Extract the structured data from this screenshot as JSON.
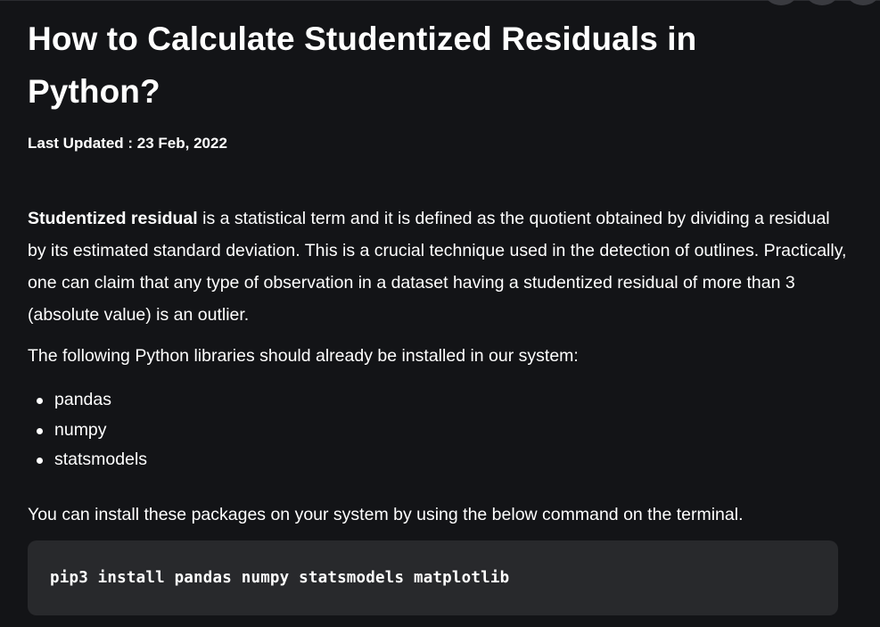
{
  "article": {
    "title": "How to Calculate Studentized Residuals in Python?",
    "last_updated": "Last Updated : 23 Feb, 2022",
    "intro": {
      "bold_term": "Studentized residual",
      "rest": " is a statistical term and it is defined as the quotient obtained by dividing a residual by its estimated standard deviation. This is a crucial technique used in the detection of outlines. Practically, one can claim that any type of observation in a dataset having a studentized residual of more than 3 (absolute value) is an outlier."
    },
    "libraries_intro": "The following Python libraries should already be installed in our system:",
    "libraries": [
      "pandas",
      "numpy",
      "statsmodels"
    ],
    "install_note": "You can install these packages on your system by using the below command on the terminal.",
    "install_command": "pip3 install pandas numpy statsmodels matplotlib"
  }
}
